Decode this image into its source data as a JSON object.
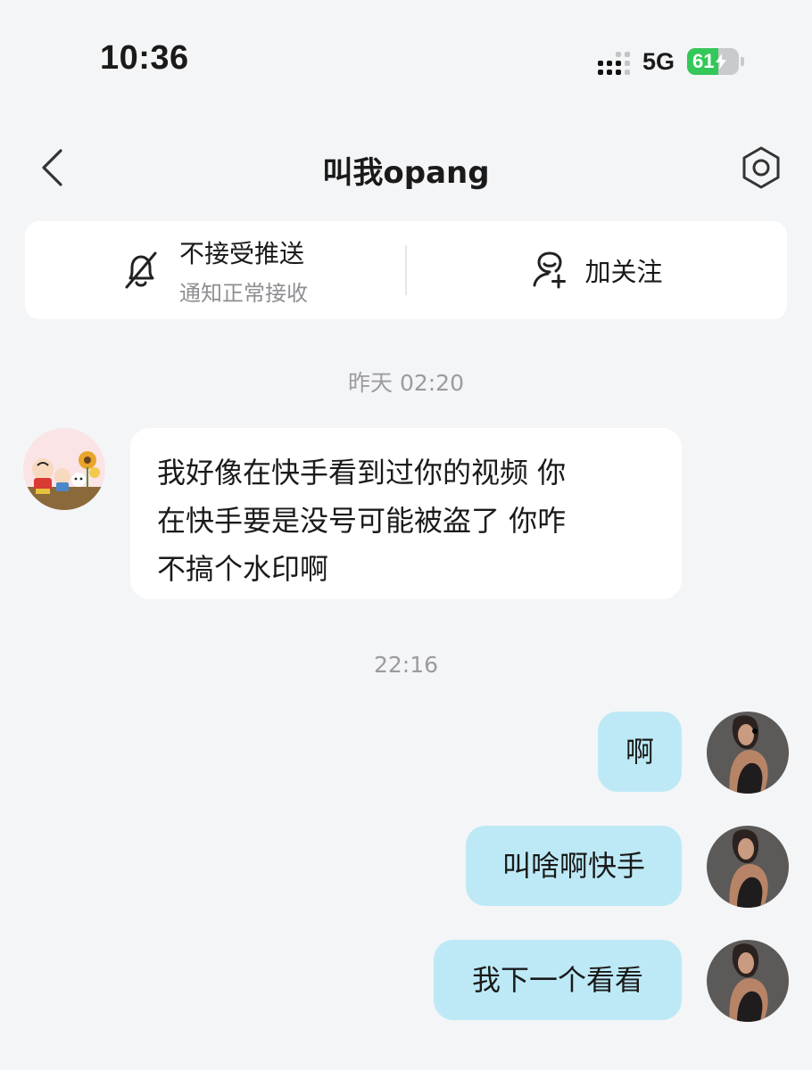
{
  "status_bar": {
    "time": "10:36",
    "network": "5G",
    "battery_level": "61",
    "battery_color": "#34c759"
  },
  "header": {
    "title": "叫我opang",
    "back_icon": "chevron-left-icon",
    "settings_icon": "hexagon-gear-icon"
  },
  "actions": {
    "notify": {
      "icon": "bell-slash-icon",
      "title": "不接受推送",
      "subtitle": "通知正常接收"
    },
    "follow": {
      "icon": "add-user-icon",
      "label": "加关注"
    }
  },
  "chat": {
    "bubble_out_color": "#bde9f6",
    "bubble_in_color": "#ffffff",
    "timestamps": [
      "昨天 02:20",
      "22:16"
    ],
    "messages": [
      {
        "from": "other",
        "lines": [
          "我好像在快手看到过你的视频 你",
          "在快手要是没号可能被盗了 你咋",
          "不搞个水印啊"
        ]
      },
      {
        "from": "me",
        "text": "啊"
      },
      {
        "from": "me",
        "text": "叫啥啊快手"
      },
      {
        "from": "me",
        "text": "我下一个看看"
      }
    ]
  }
}
